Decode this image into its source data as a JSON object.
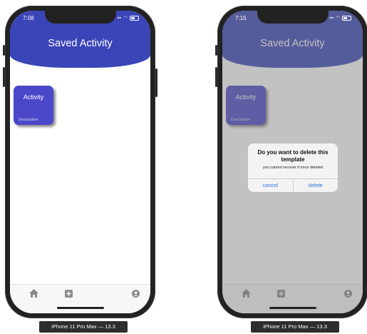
{
  "left": {
    "status_time": "7:08",
    "header_title": "Saved Activity",
    "card": {
      "title": "Activity",
      "description": "Description"
    },
    "device_caption": "iPhone 11 Pro Max — 13.3"
  },
  "right": {
    "status_time": "7:15",
    "header_title": "Saved Activity",
    "card": {
      "title": "Activity",
      "description": "Description"
    },
    "dialog": {
      "title": "Do you want to delete this template",
      "message": "you cannot recover it once deleted",
      "cancel_label": "cancel",
      "delete_label": "delete"
    },
    "device_caption": "iPhone 11 Pro Max — 13.3"
  },
  "tabbar": {
    "icons": [
      "home-icon",
      "plus-square-icon",
      "account-icon"
    ]
  },
  "colors": {
    "header": "#3a45b8",
    "card": "#4b47c9",
    "dialog_button": "#2f73d9"
  }
}
